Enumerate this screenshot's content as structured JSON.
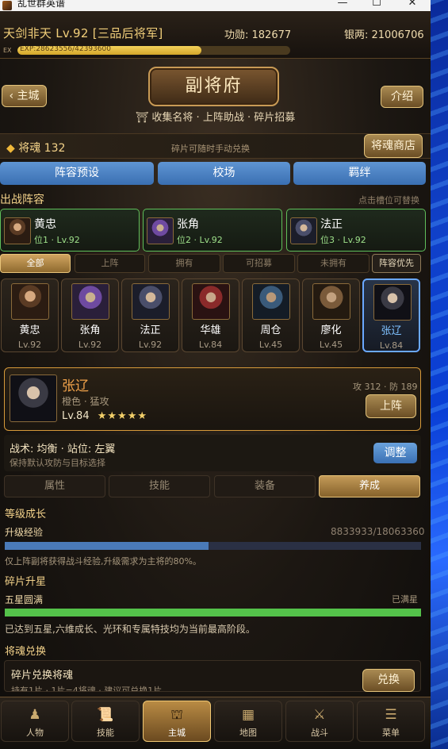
{
  "window": {
    "title": "乱世群英谱"
  },
  "player": {
    "title": "天剑非天 Lv.92 [三品后将军]",
    "merit": "功勋: 182677",
    "silver": "银两: 21006706",
    "exp_label": "EX",
    "exp_text": "EXP:28623556/42393600",
    "exp_fraction": 0.675
  },
  "page": {
    "back_label": "‹ 主城",
    "title": "副将府",
    "intro_label": "介绍",
    "subtitle": "收集名将 · 上阵助战 · 碎片招募"
  },
  "soul": {
    "count_label": "将魂 132",
    "hint": "碎片可随时手动兑换",
    "shop_label": "将魂商店"
  },
  "top_buttons": [
    "阵容预设",
    "校场",
    "羁绊"
  ],
  "lineup": {
    "title": "出战阵容",
    "hint": "点击槽位可替换",
    "slots": [
      {
        "name": "黄忠",
        "sub": "位1 · Lv.92"
      },
      {
        "name": "张角",
        "sub": "位2 · Lv.92"
      },
      {
        "name": "法正",
        "sub": "位3 · Lv.92"
      }
    ]
  },
  "filters": [
    "全部",
    "上阵",
    "拥有",
    "可招募",
    "未拥有",
    "阵容优先"
  ],
  "generals": [
    {
      "name": "黄忠",
      "lv": "Lv.92"
    },
    {
      "name": "张角",
      "lv": "Lv.92"
    },
    {
      "name": "法正",
      "lv": "Lv.92"
    },
    {
      "name": "华雄",
      "lv": "Lv.84"
    },
    {
      "name": "周仓",
      "lv": "Lv.45"
    },
    {
      "name": "廖化",
      "lv": "Lv.45"
    },
    {
      "name": "张辽",
      "lv": "Lv.84"
    }
  ],
  "selected": {
    "name": "张辽",
    "type": "橙色 · 猛攻",
    "level": "Lv.84",
    "stars": "★★★★★",
    "stats": "攻 312 · 防 189",
    "deploy_label": "上阵",
    "tactic": "战术: 均衡 · 站位: 左翼",
    "tactic_desc": "保持默认攻防与目标选择",
    "adjust_label": "调整"
  },
  "detail_tabs": [
    "属性",
    "技能",
    "装备",
    "养成"
  ],
  "growth": {
    "section": "等级成长",
    "exp_label": "升级经验",
    "exp_value": "8833933/18063360",
    "exp_fraction": 0.489,
    "note": "仅上阵副将获得战斗经验,升级需求为主将的80%。"
  },
  "star": {
    "section": "碎片升星",
    "label": "五星圆满",
    "status": "已满星",
    "fraction": 1.0,
    "note": "已达到五星,六维成长、光环和专属特技均为当前最高阶段。"
  },
  "exchange": {
    "section": "将魂兑换",
    "title": "碎片兑换将魂",
    "desc": "持有1片 · 1片=4将魂 · 建议可兑换1片",
    "button": "兑换"
  },
  "nav": [
    {
      "label": "人物",
      "icon": "person-icon"
    },
    {
      "label": "技能",
      "icon": "scroll-icon"
    },
    {
      "label": "主城",
      "icon": "castle-icon"
    },
    {
      "label": "地图",
      "icon": "map-icon"
    },
    {
      "label": "战斗",
      "icon": "crossed-swords-icon"
    },
    {
      "label": "菜单",
      "icon": "menu-icon"
    }
  ],
  "colors": {
    "accent_gold": "#e2c27a",
    "blue_button": "#4a80c2",
    "exp_bar": "#4a7ab8",
    "star_bar": "#54c24a",
    "selected_border": "#6aa8ff",
    "orange_name": "#f0a24a"
  }
}
